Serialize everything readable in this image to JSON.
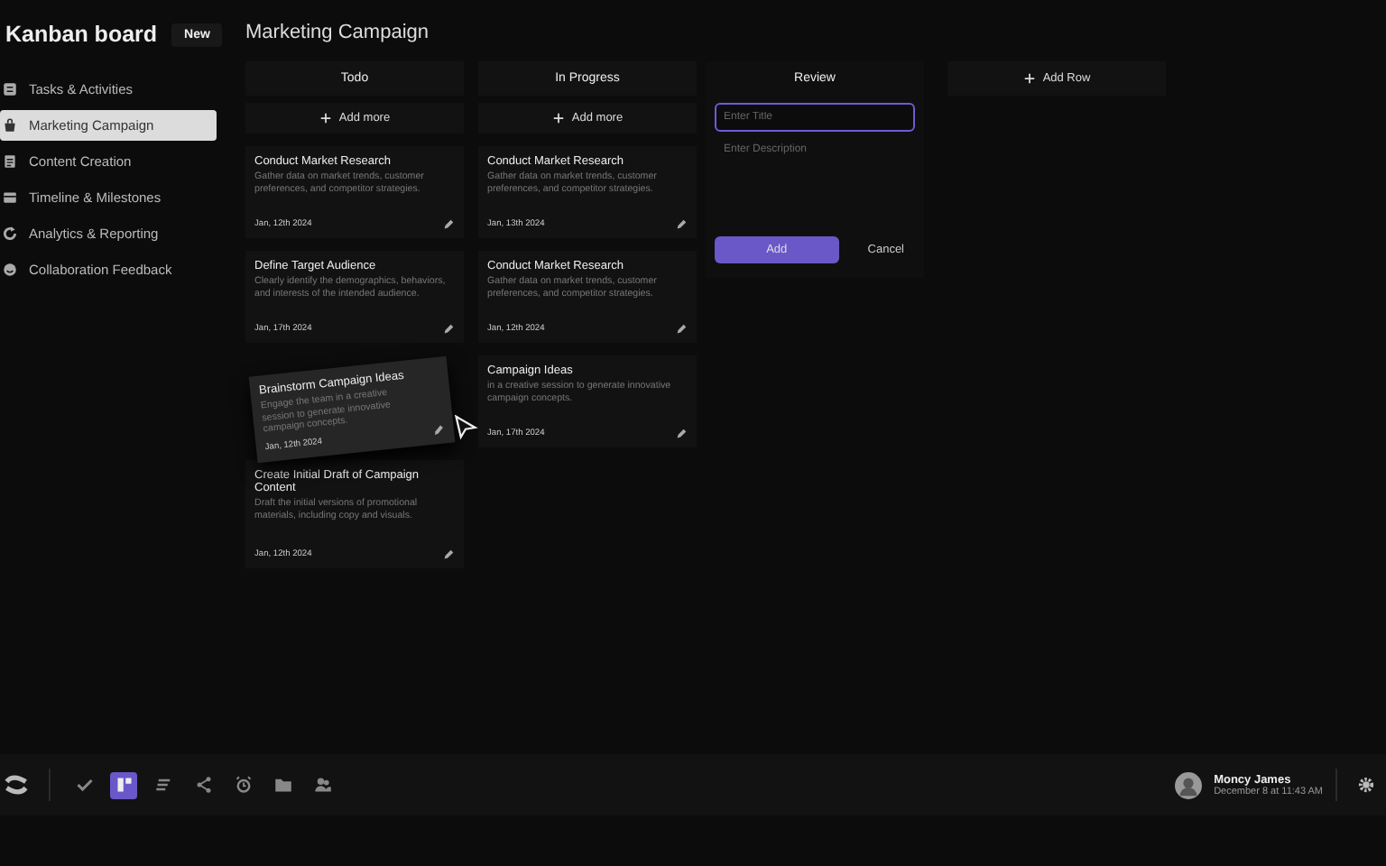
{
  "sidebar": {
    "title": "Kanban board",
    "badge": "New",
    "items": [
      {
        "label": "Tasks & Activities",
        "selected": false
      },
      {
        "label": "Marketing Campaign",
        "selected": true
      },
      {
        "label": "Content Creation",
        "selected": false
      },
      {
        "label": "Timeline & Milestones",
        "selected": false
      },
      {
        "label": "Analytics & Reporting",
        "selected": false
      },
      {
        "label": "Collaboration Feedback",
        "selected": false
      }
    ]
  },
  "board": {
    "title": "Marketing Campaign",
    "columns": [
      {
        "kind": "list",
        "title": "Todo",
        "add_label": "Add more",
        "cards": [
          {
            "kind": "card",
            "title": "Conduct Market Research",
            "description": "Gather data on market trends, customer preferences, and competitor strategies.",
            "date": "Jan, 12th 2024"
          },
          {
            "kind": "card",
            "title": "Define Target Audience",
            "description": "Clearly identify the demographics, behaviors, and interests of the intended audience.",
            "date": "Jan, 17th 2024"
          },
          {
            "kind": "empty"
          },
          {
            "kind": "card",
            "title": "Create Initial Draft of Campaign Content",
            "description": "Draft the initial versions of promotional materials, including copy and visuals.",
            "date": "Jan, 12th 2024"
          }
        ]
      },
      {
        "kind": "list",
        "title": "In Progress",
        "add_label": "Add more",
        "cards": [
          {
            "kind": "card",
            "title": "Conduct Market Research",
            "description": "Gather data on market trends, customer preferences, and competitor strategies.",
            "date": "Jan, 13th 2024"
          },
          {
            "kind": "card",
            "title": "Conduct Market Research",
            "description": "Gather data on market trends, customer preferences, and competitor strategies.",
            "date": "Jan, 12th 2024"
          },
          {
            "kind": "card",
            "title": "Campaign Ideas",
            "description": "in a creative session to generate innovative campaign concepts.",
            "date": "Jan, 17th 2024"
          }
        ]
      },
      {
        "kind": "form",
        "title": "Review",
        "title_placeholder": "Enter Title",
        "description_placeholder": "Enter Description",
        "submit": "Add",
        "cancel": "Cancel"
      },
      {
        "kind": "add",
        "add_label": "Add Row"
      }
    ],
    "dragged_card": {
      "title": "Brainstorm Campaign Ideas",
      "description": "Engage the team in a creative session to generate innovative campaign concepts.",
      "date": "Jan, 12th 2024"
    }
  },
  "taskbar": {
    "tools": [
      {
        "selected": false
      },
      {
        "selected": true
      },
      {
        "selected": false
      },
      {
        "selected": false
      },
      {
        "selected": false
      },
      {
        "selected": false
      },
      {
        "selected": false
      }
    ],
    "user": {
      "name": "Moncy James",
      "time": "December 8 at 11:43 AM"
    }
  }
}
